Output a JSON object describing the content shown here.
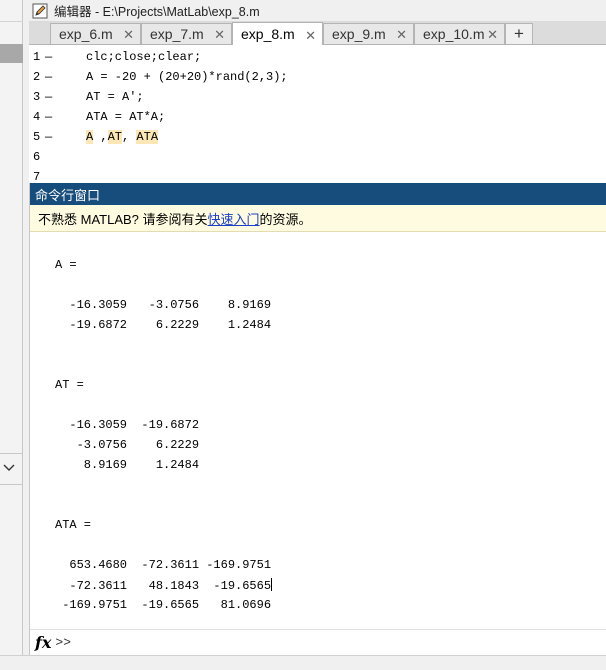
{
  "editor": {
    "title": "编辑器 - E:\\Projects\\MatLab\\exp_8.m",
    "tabs": [
      {
        "label": "exp_6.m",
        "active": false
      },
      {
        "label": "exp_7.m",
        "active": false
      },
      {
        "label": "exp_8.m",
        "active": true
      },
      {
        "label": "exp_9.m",
        "active": false
      },
      {
        "label": "exp_10.m",
        "active": false
      }
    ],
    "tab_close_glyph": "✕",
    "add_tab_glyph": "+",
    "code_lines": [
      {
        "num": "1",
        "marker": "—",
        "text": "clc;close;clear;"
      },
      {
        "num": "2",
        "marker": "—",
        "text": "A = -20 + (20+20)*rand(2,3);"
      },
      {
        "num": "3",
        "marker": "—",
        "text": "AT = A';"
      },
      {
        "num": "4",
        "marker": "—",
        "text": "ATA = AT*A;"
      },
      {
        "num": "5",
        "marker": "—",
        "text_parts": [
          "A",
          " ,",
          "AT",
          ", ",
          "ATA"
        ]
      },
      {
        "num": "6",
        "marker": "",
        "text": ""
      },
      {
        "num": "7",
        "marker": "",
        "text": ""
      }
    ]
  },
  "command_window": {
    "title": "命令行窗口",
    "notice_prefix": "不熟悉 MATLAB? 请参阅有关",
    "notice_link": "快速入门",
    "notice_suffix": "的资源。",
    "output_lines": [
      "A =",
      "",
      "  -16.3059   -3.0756    8.9169",
      "  -19.6872    6.2229    1.2484",
      "",
      "",
      "AT =",
      "",
      "  -16.3059  -19.6872",
      "   -3.0756    6.2229",
      "    8.9169    1.2484",
      "",
      "",
      "ATA =",
      "",
      "  653.4680  -72.3611 -169.9751",
      "  -72.3611   48.1843  -19.6565",
      " -169.9751  -19.6565   81.0696"
    ],
    "prompt": ">>",
    "fx_label": "fx"
  },
  "colors": {
    "command_title_bg": "#174d7d",
    "notice_bg": "#fefbe0",
    "link": "#1a3fc9",
    "highlight": "#fbe6b6"
  }
}
